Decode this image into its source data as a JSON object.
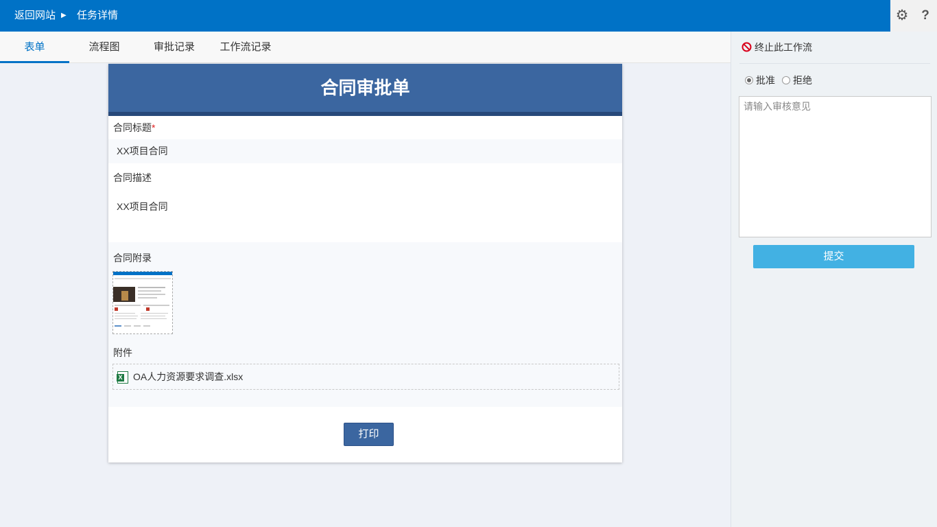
{
  "topbar": {
    "back_label": "返回网站",
    "separator_glyph": "▶",
    "current_label": "任务详情",
    "settings_icon": "⚙",
    "help_icon": "?"
  },
  "tabs": [
    {
      "label": "表单",
      "active": true
    },
    {
      "label": "流程图",
      "active": false
    },
    {
      "label": "审批记录",
      "active": false
    },
    {
      "label": "工作流记录",
      "active": false
    }
  ],
  "form": {
    "title": "合同审批单",
    "fields": {
      "contract_title": {
        "label": "合同标题",
        "required_mark": "*",
        "value": "XX项目合同"
      },
      "contract_desc": {
        "label": "合同描述",
        "value": "XX项目合同"
      },
      "contract_appendix": {
        "label": "合同附录"
      },
      "attachments": {
        "label": "附件",
        "files": [
          "OA人力资源要求调查.xlsx"
        ],
        "file_icon": "X"
      }
    },
    "print_label": "打印"
  },
  "panel": {
    "terminate_label": "终止此工作流",
    "decision": {
      "options": [
        {
          "label": "批准",
          "checked": true
        },
        {
          "label": "拒绝",
          "checked": false
        }
      ]
    },
    "opinion_placeholder": "请输入审核意见",
    "opinion_value": "",
    "submit_label": "提交"
  },
  "colors": {
    "topbar": "#0072c6",
    "form_header": "#3b66a0",
    "submit": "#42b1e3",
    "terminate_icon": "#d9001b"
  }
}
